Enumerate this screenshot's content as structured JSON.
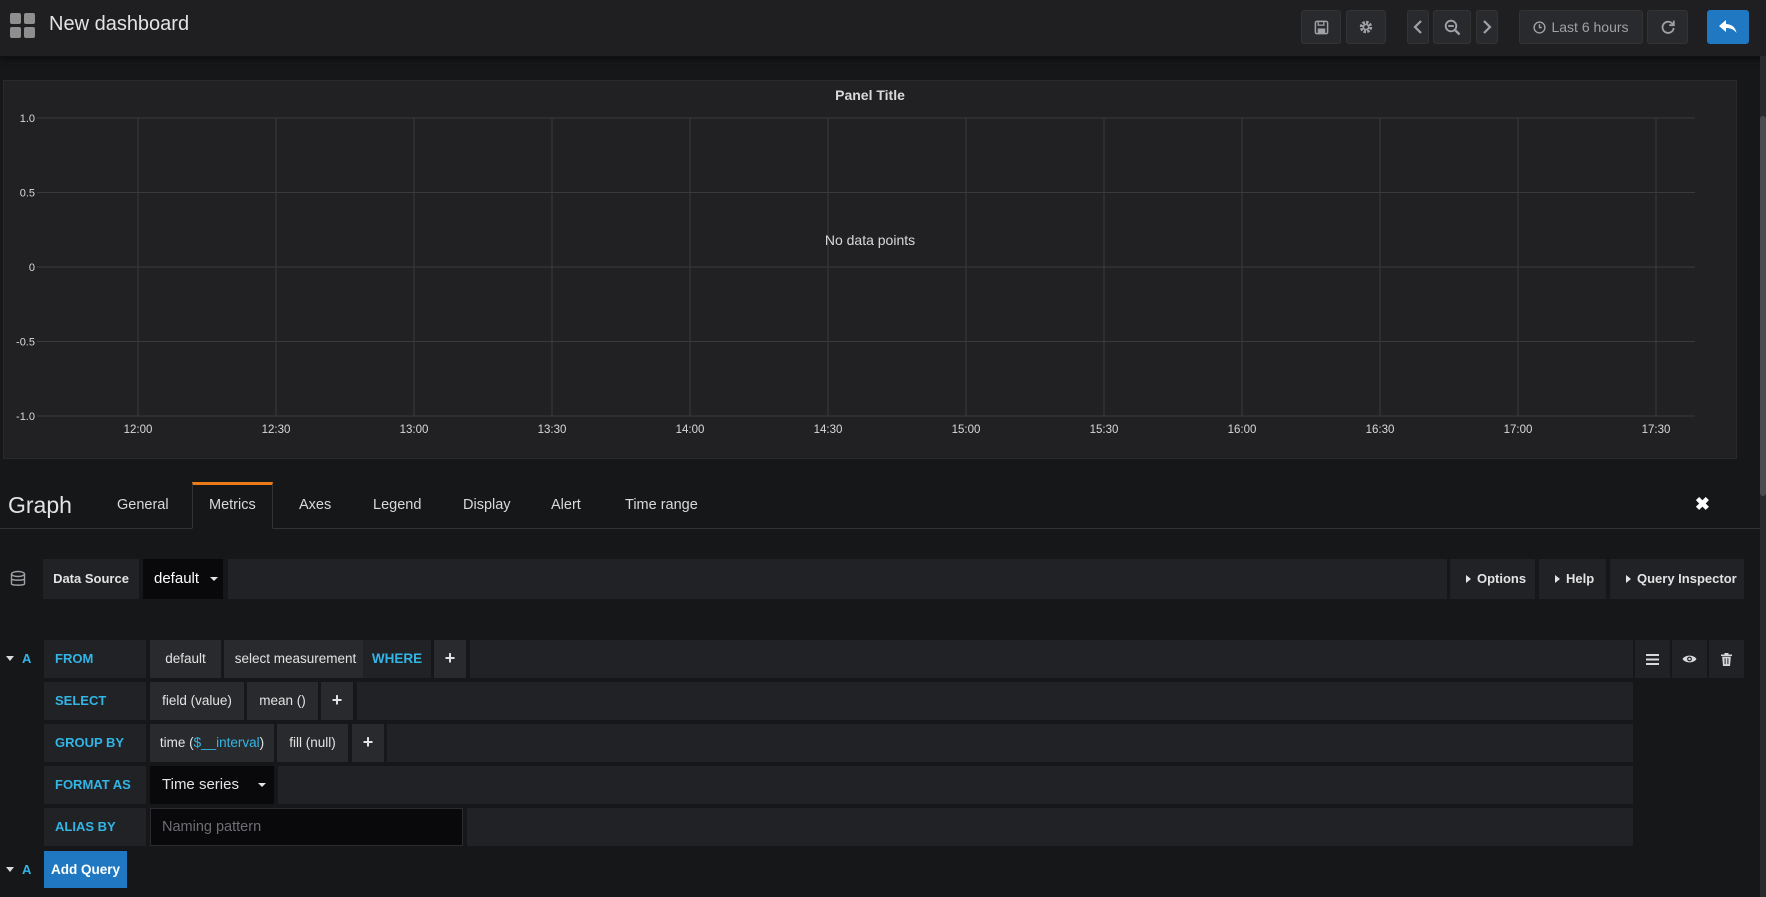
{
  "header": {
    "title": "New dashboard",
    "time_range": "Last 6 hours"
  },
  "panel": {
    "title": "Panel Title",
    "no_data": "No data points"
  },
  "chart_data": {
    "type": "line",
    "title": "Panel Title",
    "series": [],
    "y_ticks": [
      "1.0",
      "0.5",
      "0",
      "-0.5",
      "-1.0"
    ],
    "x_ticks": [
      "12:00",
      "12:30",
      "13:00",
      "13:30",
      "14:00",
      "14:30",
      "15:00",
      "15:30",
      "16:00",
      "16:30",
      "17:00",
      "17:30"
    ],
    "ylim": [
      -1.0,
      1.0
    ],
    "grid": true,
    "annotation": "No data points"
  },
  "editor": {
    "title": "Graph",
    "tabs": [
      "General",
      "Metrics",
      "Axes",
      "Legend",
      "Display",
      "Alert",
      "Time range"
    ],
    "active_tab": "Metrics",
    "close": "✖"
  },
  "datasource": {
    "label": "Data Source",
    "value": "default",
    "options_btn": "Options",
    "help_btn": "Help",
    "inspector_btn": "Query Inspector"
  },
  "query": {
    "ref": "A",
    "from": {
      "label": "FROM",
      "policy": "default",
      "measurement": "select measurement",
      "where": "WHERE"
    },
    "select": {
      "label": "SELECT",
      "field": "field (value)",
      "func": "mean ()"
    },
    "group_by": {
      "label": "GROUP BY",
      "time_prefix": "time (",
      "time_var": "$__interval",
      "time_suffix": ")",
      "fill": "fill (null)"
    },
    "format_as": {
      "label": "FORMAT AS",
      "value": "Time series"
    },
    "alias_by": {
      "label": "ALIAS BY",
      "placeholder": "Naming pattern"
    },
    "plus": "+"
  },
  "add_query": {
    "ref": "A",
    "label": "Add Query"
  },
  "colors": {
    "accent": "#33b5e5",
    "primary_button": "#1f78c1",
    "active_tab_border": "#eb7b18"
  }
}
